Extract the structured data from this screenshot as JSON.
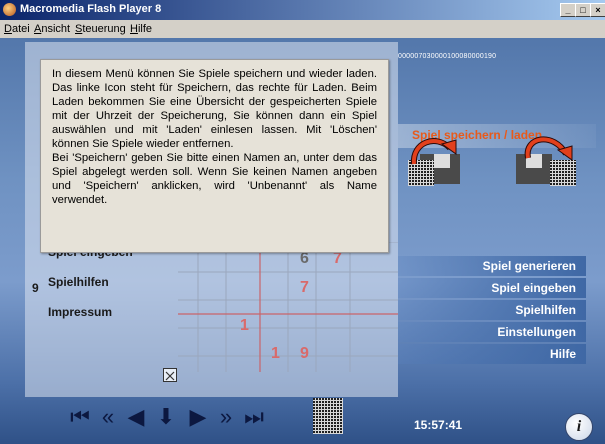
{
  "window": {
    "title": "Macromedia Flash Player 8",
    "buttons": [
      "_",
      "□",
      "×"
    ]
  },
  "menubar": {
    "items": [
      {
        "label": "atei",
        "mnemonic": "D"
      },
      {
        "label": "nsicht",
        "mnemonic": "A"
      },
      {
        "label": "teuerung",
        "mnemonic": "S"
      },
      {
        "label": "ilfe",
        "mnemonic": "H"
      }
    ]
  },
  "stage": {
    "id_string": "000007030000100080000190",
    "right_title": "Spiel speichern / laden",
    "right_menu": [
      "Spiel generieren",
      "Spiel eingeben",
      "Spielhilfen",
      "Einstellungen",
      "Hilfe"
    ],
    "left_menu": [
      "Spiel eingeben",
      "Spielhilfen",
      "Impressum"
    ],
    "left_menu_prefix": "9",
    "grid_numbers": [
      {
        "value": "6",
        "color": "#6a6a6a"
      },
      {
        "value": "7",
        "color": "#d96a6a"
      },
      {
        "value": "7",
        "color": "#d96a6a"
      },
      {
        "value": "1",
        "color": "#d96a6a"
      },
      {
        "value": "1",
        "color": "#d96a6a"
      },
      {
        "value": "9",
        "color": "#d96a6a"
      }
    ],
    "close_box": "☒",
    "tooltip": "In diesem Menü können Sie Spiele speichern und wieder laden. Das linke Icon steht für Speichern, das rechte für Laden. Beim Laden bekommen Sie eine Übersicht der gespeicherten Spiele mit der Uhrzeit der Speicherung, Sie können dann ein Spiel auswählen und mit 'Laden' einlesen lassen. Mit 'Löschen' können Sie Spiele wieder entfernen.\nBei 'Speichern' geben Sie bitte einen Namen an, unter dem das Spiel abgelegt werden soll. Wenn Sie keinen Namen angeben und 'Speichern' anklicken, wird 'Unbenannt' als Name verwendet.",
    "clock": "15:57:41",
    "info_label": "i",
    "nav": [
      "⏮",
      "«",
      "◀",
      "⬇",
      "▶",
      "»",
      "⏭"
    ]
  },
  "colors": {
    "accent_orange": "#e85a1a",
    "menu_blue": "#3f68a5"
  }
}
